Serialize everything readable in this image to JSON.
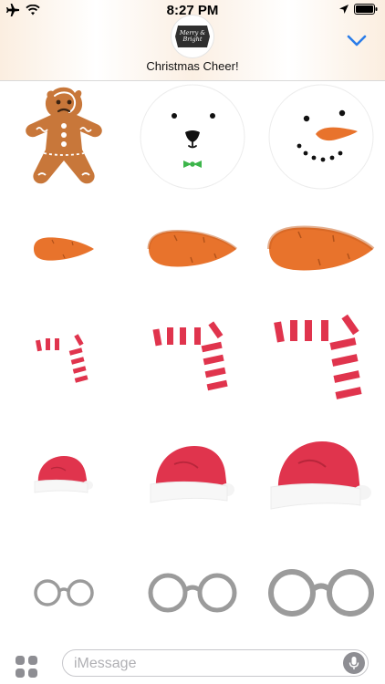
{
  "status_bar": {
    "time": "8:27 PM",
    "icons": [
      "airplane-icon",
      "wifi-icon",
      "location-arrow-icon",
      "battery-icon"
    ]
  },
  "header": {
    "app_name": "Christmas Cheer!",
    "badge_text_line1": "Merry &",
    "badge_text_line2": "Bright",
    "collapse_icon": "chevron-down-icon",
    "accent_color": "#2b7de9"
  },
  "stickers": [
    {
      "name": "gingerbread-man-sticker"
    },
    {
      "name": "polar-bear-face-sticker"
    },
    {
      "name": "snowman-face-sticker"
    },
    {
      "name": "carrot-nose-small-sticker"
    },
    {
      "name": "carrot-nose-medium-sticker"
    },
    {
      "name": "carrot-nose-large-sticker"
    },
    {
      "name": "scarf-small-sticker"
    },
    {
      "name": "scarf-medium-sticker"
    },
    {
      "name": "scarf-large-sticker"
    },
    {
      "name": "santa-hat-small-sticker"
    },
    {
      "name": "santa-hat-medium-sticker"
    },
    {
      "name": "santa-hat-large-sticker"
    },
    {
      "name": "glasses-small-sticker"
    },
    {
      "name": "glasses-medium-sticker"
    },
    {
      "name": "glasses-large-sticker"
    }
  ],
  "colors": {
    "carrot": "#e8732c",
    "scarf_red": "#e0344d",
    "hat_red": "#e0344d",
    "glasses_gray": "#9b9b9b",
    "gingerbread": "#c8773a"
  },
  "compose": {
    "placeholder": "iMessage",
    "apps_icon": "app-drawer-icon",
    "mic_icon": "microphone-icon"
  }
}
